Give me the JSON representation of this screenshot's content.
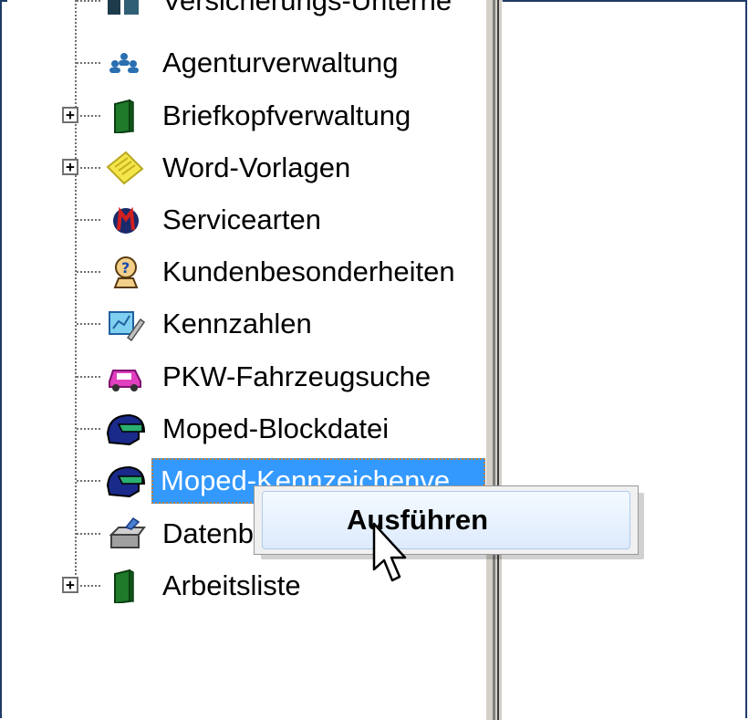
{
  "tree": {
    "items": [
      {
        "label": "Versicherungs-Unterne",
        "icon": "building-icon",
        "expandable": false
      },
      {
        "label": "Agenturverwaltung",
        "icon": "people-icon",
        "expandable": false
      },
      {
        "label": "Briefkopfverwaltung",
        "icon": "green-book-icon",
        "expandable": true
      },
      {
        "label": "Word-Vorlagen",
        "icon": "notepad-icon",
        "expandable": true
      },
      {
        "label": "Servicearten",
        "icon": "service-icon",
        "expandable": false
      },
      {
        "label": "Kundenbesonderheiten",
        "icon": "question-person-icon",
        "expandable": false
      },
      {
        "label": "Kennzahlen",
        "icon": "pen-chart-icon",
        "expandable": false
      },
      {
        "label": "PKW-Fahrzeugsuche",
        "icon": "pink-car-icon",
        "expandable": false
      },
      {
        "label": "Moped-Blockdatei",
        "icon": "helmet-icon",
        "expandable": false
      },
      {
        "label": "Moped-Kennzeichenve",
        "icon": "helmet-icon",
        "expandable": false,
        "selected": true
      },
      {
        "label": "Datenb",
        "icon": "database-icon",
        "expandable": false
      },
      {
        "label": "Arbeitsliste",
        "icon": "green-book-icon",
        "expandable": true
      }
    ]
  },
  "context_menu": {
    "items": [
      {
        "label": "Ausführen"
      }
    ]
  },
  "colors": {
    "selection": "#3399ff",
    "menu_highlight": "#dcebfc",
    "frame": "#1f3a66"
  }
}
